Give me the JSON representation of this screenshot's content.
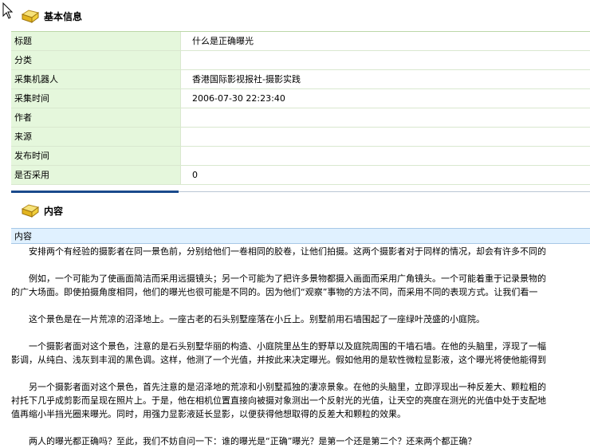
{
  "basic_info": {
    "title": "基本信息",
    "rows": [
      {
        "label": "标题",
        "value": "什么是正确曝光"
      },
      {
        "label": "分类",
        "value": ""
      },
      {
        "label": "采集机器人",
        "value": "香港国际影视报社-摄影实践"
      },
      {
        "label": "采集时间",
        "value": "2006-07-30 22:23:40"
      },
      {
        "label": "作者",
        "value": ""
      },
      {
        "label": "来源",
        "value": ""
      },
      {
        "label": "发布时间",
        "value": ""
      },
      {
        "label": "是否采用",
        "value": "0"
      }
    ]
  },
  "content": {
    "title": "内容",
    "field_label": "内容",
    "lines": [
      "　　安排两个有经验的摄影者在同一景色前，分别给他们一卷相同的胶卷，让他们拍摄。这两个摄影者对于同样的情况，却会有许多不同的",
      "",
      "　　例如，一个可能为了使画面简洁而采用远摄镜头；另一个可能为了把许多景物都摄入画面而采用广角镜头。一个可能着重于记录景物的",
      "的广大场面。即使拍摄角度相同，他们的曝光也很可能是不同的。因为他们“观察”事物的方法不同，而采用不同的表现方式。让我们看一",
      "",
      "　　这个景色是在一片荒凉的沼泽地上。一座古老的石头别墅座落在小丘上。别墅前用石墙围起了一座绿叶茂盛的小庭院。",
      "",
      "　　一个摄影者面对这个景色，注意的是石头别墅华丽的构造、小庭院里丛生的野草以及庭院周围的干墙石墙。在他的头脑里，浮现了一幅",
      "影调，从纯白、浅灰到丰润的黑色调。这样，他测了一个光值，并按此来决定曝光。假如他用的是软性微粒显影液，这个曝光将使他能得到",
      "",
      "　　另一个摄影者面对这个景色，首先注意的是沼泽地的荒凉和小别墅孤独的凄凉景象。在他的头脑里，立即浮现出一种反差大、颗粒粗的",
      "衬托下几乎成剪影而呈现在照片上。于是，他在相机位置直接向被摄对象测出一个反射光的光值，让天空的亮度在测光的光值中处于支配地",
      "值再缩小半挡光圈来曝光。同时，用强力显影液延长显影，以便获得他想取得的反差大和颗粒的效果。",
      "",
      "　　两人的曝光都正确吗？至此，我们不妨自问一下：谁的曝光是“正确”曝光？是第一个还是第二个？还来两个都正确？"
    ]
  }
}
